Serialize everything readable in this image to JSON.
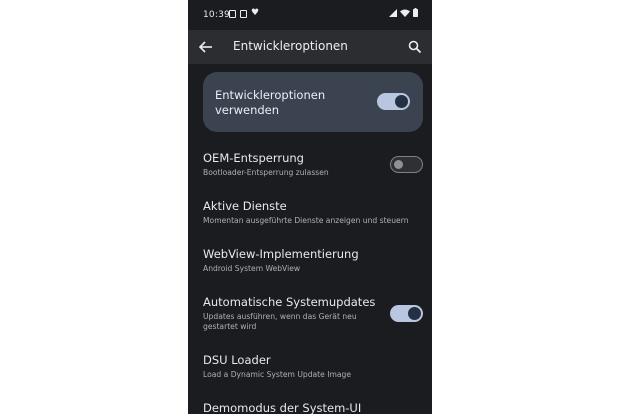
{
  "status_bar": {
    "time": "10:39"
  },
  "header": {
    "title": "Entwickleroptionen"
  },
  "master_switch": {
    "label": "Entwickleroptionen verwenden",
    "state": "on"
  },
  "settings": [
    {
      "title": "OEM-Entsperrung",
      "subtitle": "Bootloader-Entsperrung zulassen",
      "toggle": "off"
    },
    {
      "title": "Aktive Dienste",
      "subtitle": "Momentan ausgeführte Dienste anzeigen und steuern"
    },
    {
      "title": "WebView-Implementierung",
      "subtitle": "Android System WebView"
    },
    {
      "title": "Automatische Systemupdates",
      "subtitle": "Updates ausführen, wenn das Gerät neu gestartet wird",
      "toggle": "on"
    },
    {
      "title": "DSU Loader",
      "subtitle": "Load a Dynamic System Update Image"
    },
    {
      "title": "Demomodus der System-UI"
    }
  ],
  "colors": {
    "background": "#1b1c20",
    "toolbar": "#2b2d31",
    "master_card": "#3b4350",
    "toggle_on_track": "#b8c6df",
    "toggle_on_knob": "#243044",
    "toggle_off_outline": "#7f8188"
  },
  "icons": {
    "back": "arrow-left-icon",
    "search": "search-icon",
    "wifi": "wifi-icon",
    "battery": "battery-icon"
  }
}
